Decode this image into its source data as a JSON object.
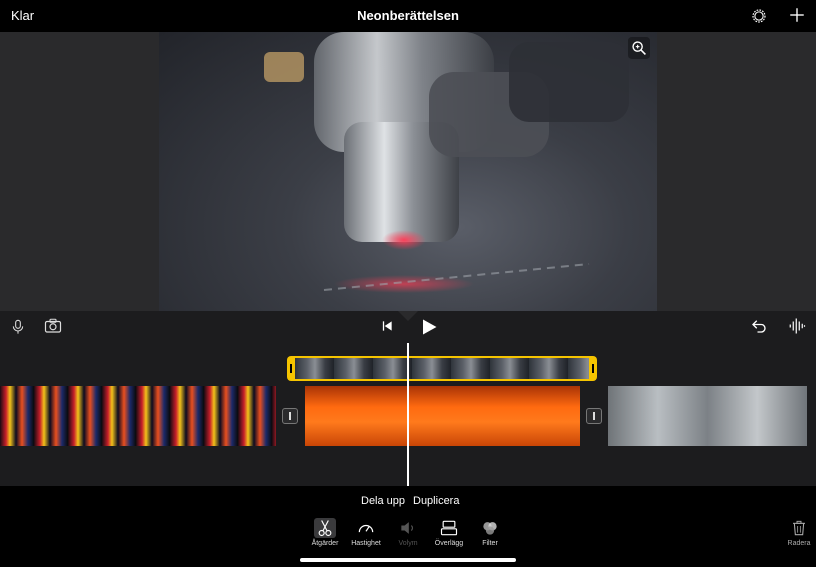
{
  "header": {
    "done_label": "Klar",
    "title": "Neonberättelsen"
  },
  "editor": {
    "split_label": "Dela upp",
    "duplicate_label": "Duplicera"
  },
  "toolbar": {
    "tools": [
      {
        "label": "Åtgärder",
        "icon": "scissors-icon",
        "active": true
      },
      {
        "label": "Hastighet",
        "icon": "speedometer-icon"
      },
      {
        "label": "Volym",
        "icon": "speaker-icon",
        "disabled": true
      },
      {
        "label": "Överlägg",
        "icon": "overlay-icon"
      },
      {
        "label": "Filter",
        "icon": "filter-icon"
      }
    ],
    "delete_label": "Radera"
  },
  "colors": {
    "overlay_clip_border": "#f5c400",
    "background": "#1c1c1e",
    "bars": "#000000"
  }
}
